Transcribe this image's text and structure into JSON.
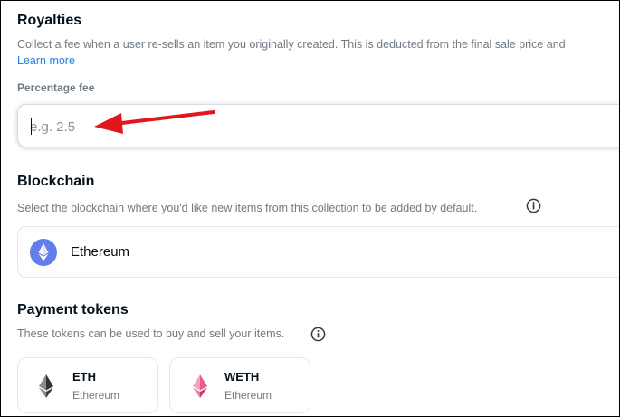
{
  "royalties": {
    "title": "Royalties",
    "description": "Collect a fee when a user re-sells an item you originally created. This is deducted from the final sale price and",
    "learn_more": "Learn more",
    "field_label": "Percentage fee",
    "placeholder": "e.g. 2.5",
    "value": ""
  },
  "blockchain": {
    "title": "Blockchain",
    "description": "Select the blockchain where you'd like new items from this collection to be added by default.",
    "selected": "Ethereum"
  },
  "payment_tokens": {
    "title": "Payment tokens",
    "description": "These tokens can be used to buy and sell your items.",
    "tokens": [
      {
        "symbol": "ETH",
        "network": "Ethereum",
        "icon": "eth-diamond-icon"
      },
      {
        "symbol": "WETH",
        "network": "Ethereum",
        "icon": "weth-diamond-icon"
      }
    ]
  },
  "colors": {
    "link": "#2081e2",
    "annotation_arrow": "#e3161d",
    "ethereum_blue": "#627eea",
    "weth_pink": "#ec5b8c"
  }
}
